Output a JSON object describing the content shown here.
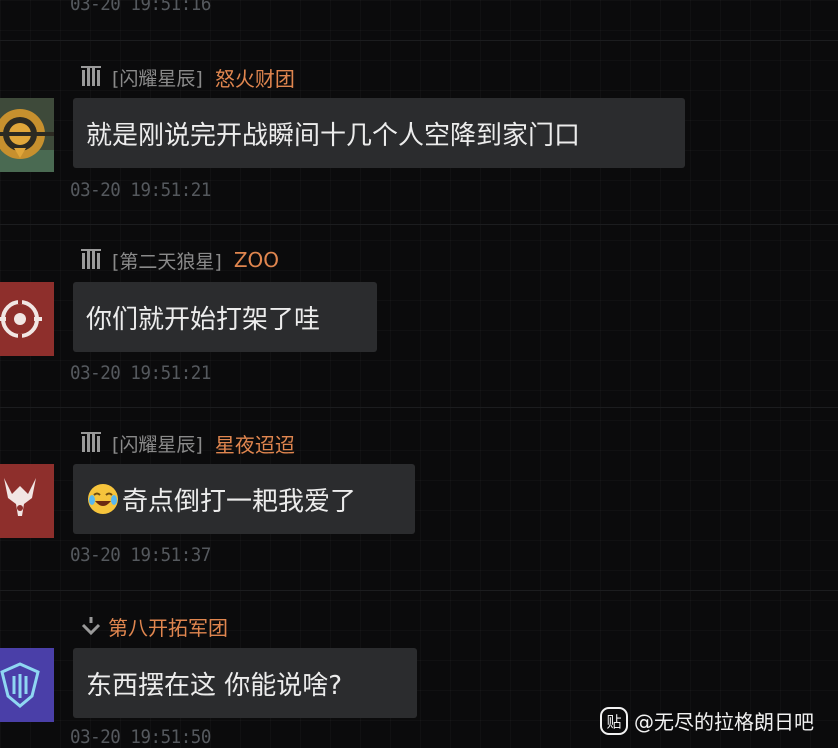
{
  "messages": [
    {
      "timestamp": "03-20 19:51:16"
    },
    {
      "guild": "[闪耀星辰]",
      "username": "怒火财团",
      "text": "就是刚说完开战瞬间十几个人空降到家门口",
      "timestamp": "03-20 19:51:21",
      "avatar_icon": "golden-emblem-icon"
    },
    {
      "guild": "[第二天狼星]",
      "username": "ZOO",
      "text": "你们就开始打架了哇",
      "timestamp": "03-20 19:51:21",
      "avatar_icon": "red-target-emblem-icon"
    },
    {
      "guild": "[闪耀星辰]",
      "username": "星夜迢迢",
      "text": "奇点倒打一耙我爱了",
      "timestamp": "03-20 19:51:37",
      "avatar_icon": "red-horned-emblem-icon"
    },
    {
      "guild": "",
      "username": "第八开拓军团",
      "text": "东西摆在这 你能说啥?",
      "timestamp": "03-20 19:51:50",
      "avatar_icon": "purple-shield-emblem-icon"
    }
  ],
  "emoji": "laughing-crying-emoji",
  "watermark": {
    "logo": "贴",
    "text": "@无尽的拉格朗日吧"
  },
  "colors": {
    "background": "#0b0b0c",
    "bubble": "#2b2c2e",
    "username": "#e0864f",
    "guild": "#8a8a8a",
    "timestamp": "#55595e"
  }
}
